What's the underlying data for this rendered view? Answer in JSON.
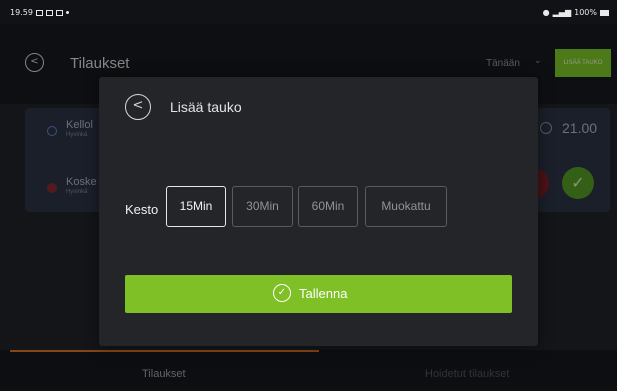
{
  "status_bar": {
    "time": "19.59",
    "left_icons": [
      "gallery-icon",
      "notification-icon",
      "photo-icon"
    ],
    "right_icons": [
      "location-icon",
      "signal-icon"
    ],
    "battery": "100%"
  },
  "header": {
    "title": "Tilaukset",
    "filter_label": "Tänään",
    "add_break_label": "LISÄÄ TAUKO"
  },
  "orders": [
    {
      "name": "Kellol",
      "city": "Hyvinkä",
      "time": "21.00"
    },
    {
      "name": "Koske",
      "city": "Hyvinkä"
    }
  ],
  "tabs": [
    {
      "label": "Tilaukset",
      "active": true
    },
    {
      "label": "Hoidetut tilaukset",
      "active": false
    }
  ],
  "modal": {
    "title": "Lisää tauko",
    "duration_label": "Kesto",
    "options": [
      {
        "label": "15Min",
        "selected": true
      },
      {
        "label": "30Min",
        "selected": false
      },
      {
        "label": "60Min",
        "selected": false
      },
      {
        "label": "Muokattu",
        "selected": false
      }
    ],
    "save_label": "Tallenna"
  },
  "colors": {
    "accent_green": "#7ec025",
    "tab_indicator": "#d87228",
    "danger": "#7a1e25"
  }
}
